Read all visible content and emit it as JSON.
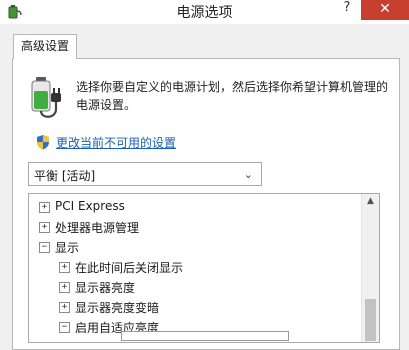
{
  "window": {
    "title": "电源选项",
    "help_label": "?",
    "close_label": "✕"
  },
  "tab": {
    "label": "高级设置"
  },
  "intro": {
    "text": "选择你要自定义的电源计划，然后选择你希望计算机管理的电源设置。"
  },
  "link": {
    "label": "更改当前不可用的设置"
  },
  "plan_select": {
    "value": "平衡 [活动]"
  },
  "tree": {
    "items": [
      {
        "label": "PCI Express",
        "expander": "+"
      },
      {
        "label": "处理器电源管理",
        "expander": "+"
      },
      {
        "label": "显示",
        "expander": "−"
      },
      {
        "label": "在此时间后关闭显示",
        "expander": "+"
      },
      {
        "label": "显示器亮度",
        "expander": "+"
      },
      {
        "label": "显示器亮度变暗",
        "expander": "+"
      },
      {
        "label": "启用自适应亮度",
        "expander": "−"
      }
    ]
  },
  "colors": {
    "close_button": "#c7402f",
    "link": "#1a5fb4",
    "battery_green": "#3fae3f"
  },
  "icons": {
    "app": "power-options-icon",
    "battery": "battery-plug-icon",
    "shield": "uac-shield-icon",
    "dropdown": "chevron-down-icon",
    "scroll_up": "scroll-up-arrow-icon"
  }
}
